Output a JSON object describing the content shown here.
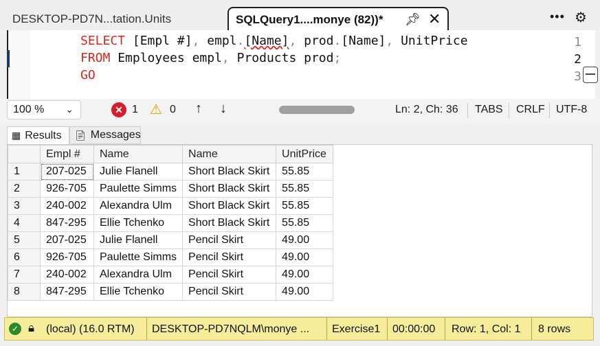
{
  "tabs": [
    {
      "label": "DESKTOP-PD7N...tation.Units"
    },
    {
      "label": "SQLQuery1....monye (82))*"
    }
  ],
  "tab_icons": {
    "pin": "pin-icon",
    "close": "close-icon",
    "more": "more-icon",
    "settings": "gear-icon"
  },
  "editor": {
    "line_numbers": [
      "1",
      "2",
      "3"
    ],
    "line1": {
      "kw": "SELECT",
      "t1": " [Empl #]",
      "c1": ",",
      "t2": " empl",
      "d1": ".",
      "t3": "[Name]",
      "c2": ",",
      "t4": " prod",
      "d2": ".",
      "t5": "[Name]",
      "c3": ",",
      "t6": " UnitPrice"
    },
    "line2": {
      "kw": "FROM",
      "t1": " Employees empl",
      "c1": ",",
      "t2": " Products prod",
      "semi": ";"
    },
    "line3": {
      "kw": "GO"
    }
  },
  "editor_status": {
    "zoom": "100 %",
    "errors": "1",
    "warnings": "0",
    "position": "Ln: 2, Ch: 36",
    "indent": "TABS",
    "line_ending": "CRLF",
    "encoding": "UTF-8"
  },
  "result_tabs": {
    "results": "Results",
    "messages": "Messages"
  },
  "grid": {
    "columns": [
      "Empl #",
      "Name",
      "Name",
      "UnitPrice"
    ],
    "rows": [
      [
        "1",
        "207-025",
        "Julie Flanell",
        "Short Black Skirt",
        "55.85"
      ],
      [
        "2",
        "926-705",
        "Paulette Simms",
        "Short Black Skirt",
        "55.85"
      ],
      [
        "3",
        "240-002",
        "Alexandra Ulm",
        "Short Black Skirt",
        "55.85"
      ],
      [
        "4",
        "847-295",
        "Ellie Tchenko",
        "Short Black Skirt",
        "55.85"
      ],
      [
        "5",
        "207-025",
        "Julie Flanell",
        "Pencil Skirt",
        "49.00"
      ],
      [
        "6",
        "926-705",
        "Paulette Simms",
        "Pencil Skirt",
        "49.00"
      ],
      [
        "7",
        "240-002",
        "Alexandra Ulm",
        "Pencil Skirt",
        "49.00"
      ],
      [
        "8",
        "847-295",
        "Ellie Tchenko",
        "Pencil Skirt",
        "49.00"
      ]
    ]
  },
  "status_bar": {
    "server": "(local) (16.0 RTM)",
    "user": "DESKTOP-PD7NQLM\\monye ...",
    "database": "Exercise1",
    "elapsed": "00:00:00",
    "rowcol": "Row: 1, Col: 1",
    "rows": "8 rows"
  },
  "colors": {
    "keyword": "#d4281b",
    "status_bar": "#f7ec9a",
    "error": "#d21f2a",
    "warning": "#e0a100"
  }
}
